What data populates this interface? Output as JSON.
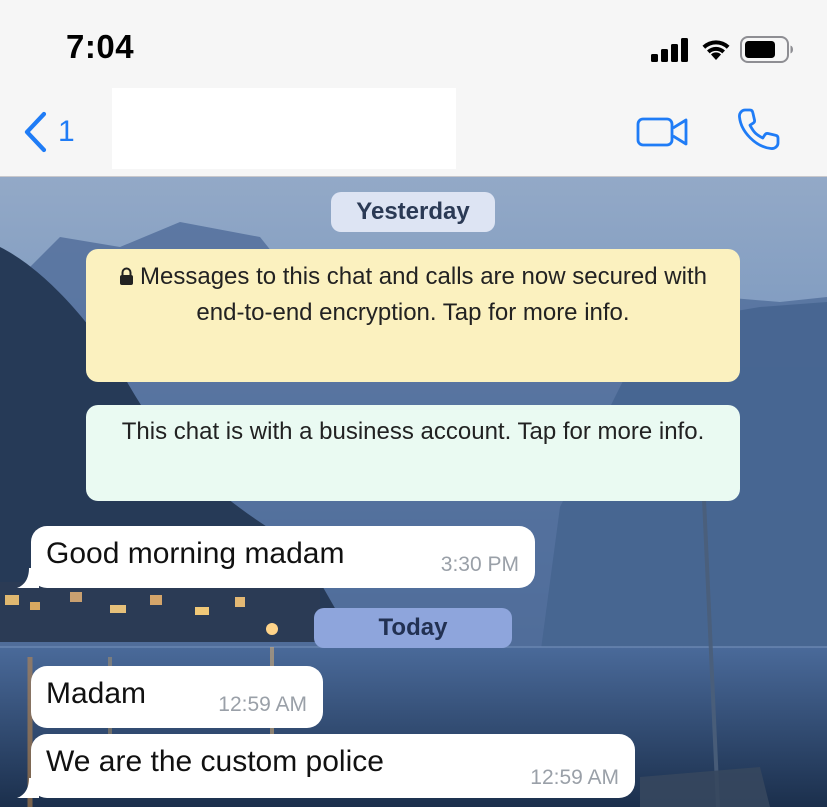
{
  "status_bar": {
    "time": "7:04",
    "icons": [
      "signal-icon",
      "wifi-icon",
      "battery-icon"
    ]
  },
  "nav": {
    "back_count": "1",
    "back_icon": "chevron-left-icon",
    "video_icon": "video-camera-icon",
    "call_icon": "phone-icon",
    "accent_color": "#1f7cf6"
  },
  "chat": {
    "date_yesterday": "Yesterday",
    "encryption_notice": "Messages to this chat and calls are now secured with end-to-end encryption. Tap for more info.",
    "business_notice": "This chat is with a business account. Tap for more info.",
    "date_today": "Today",
    "messages": [
      {
        "text": "Good morning madam",
        "time": "3:30 PM"
      },
      {
        "text": "Madam",
        "time": "12:59 AM"
      },
      {
        "text": "We are the custom police",
        "time": "12:59 AM"
      }
    ]
  }
}
